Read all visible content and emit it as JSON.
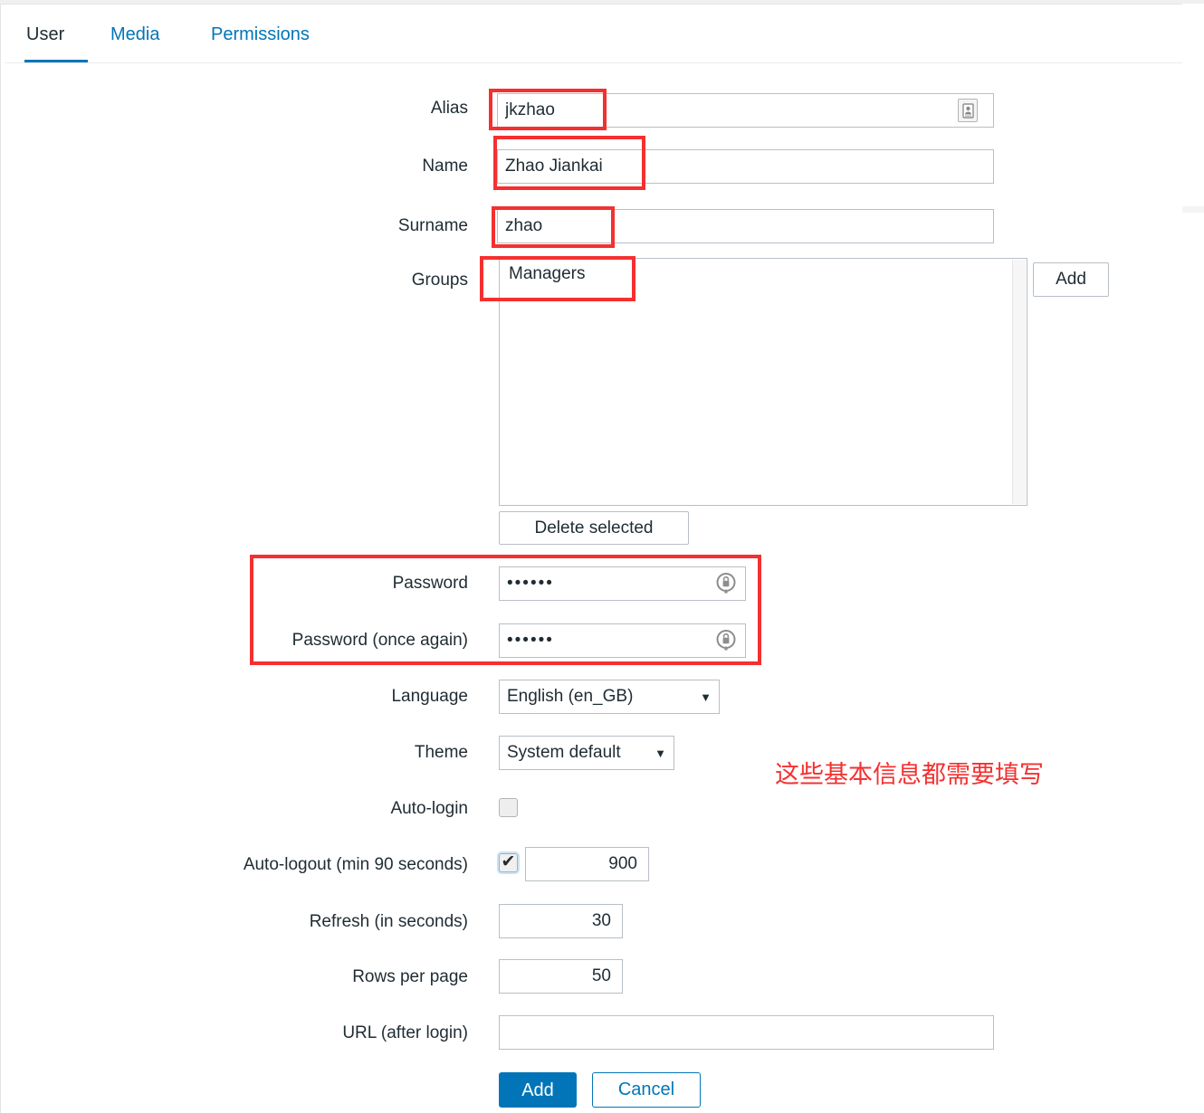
{
  "tabs": [
    {
      "label": "User",
      "active": true
    },
    {
      "label": "Media",
      "active": false
    },
    {
      "label": "Permissions",
      "active": false
    }
  ],
  "form": {
    "alias": {
      "label": "Alias",
      "value": "jkzhao",
      "icon": "id-card-icon"
    },
    "name": {
      "label": "Name",
      "value": "Zhao Jiankai"
    },
    "surname": {
      "label": "Surname",
      "value": "zhao"
    },
    "groups": {
      "label": "Groups",
      "options": [
        "Managers"
      ],
      "add_button": "Add",
      "delete_button": "Delete selected"
    },
    "password": {
      "label": "Password",
      "value": "••••••",
      "icon": "lock-circle-icon"
    },
    "password_again": {
      "label": "Password (once again)",
      "value": "••••••",
      "icon": "lock-circle-icon"
    },
    "language": {
      "label": "Language",
      "value": "English (en_GB)"
    },
    "theme": {
      "label": "Theme",
      "value": "System default"
    },
    "auto_login": {
      "label": "Auto-login",
      "checked": false
    },
    "auto_logout": {
      "label": "Auto-logout (min 90 seconds)",
      "checked": true,
      "value": "900"
    },
    "refresh": {
      "label": "Refresh (in seconds)",
      "value": "30"
    },
    "rows_per_page": {
      "label": "Rows per page",
      "value": "50"
    },
    "url_after_login": {
      "label": "URL (after login)",
      "value": ""
    }
  },
  "footer": {
    "submit_label": "Add",
    "cancel_label": "Cancel"
  },
  "annotation": {
    "note_text": "这些基本信息都需要填写",
    "highlight_color": "#f43030"
  },
  "colors": {
    "accent": "#0275b8",
    "text": "#1f2c33",
    "border": "#b8bfc5",
    "annotation": "#f43030"
  }
}
